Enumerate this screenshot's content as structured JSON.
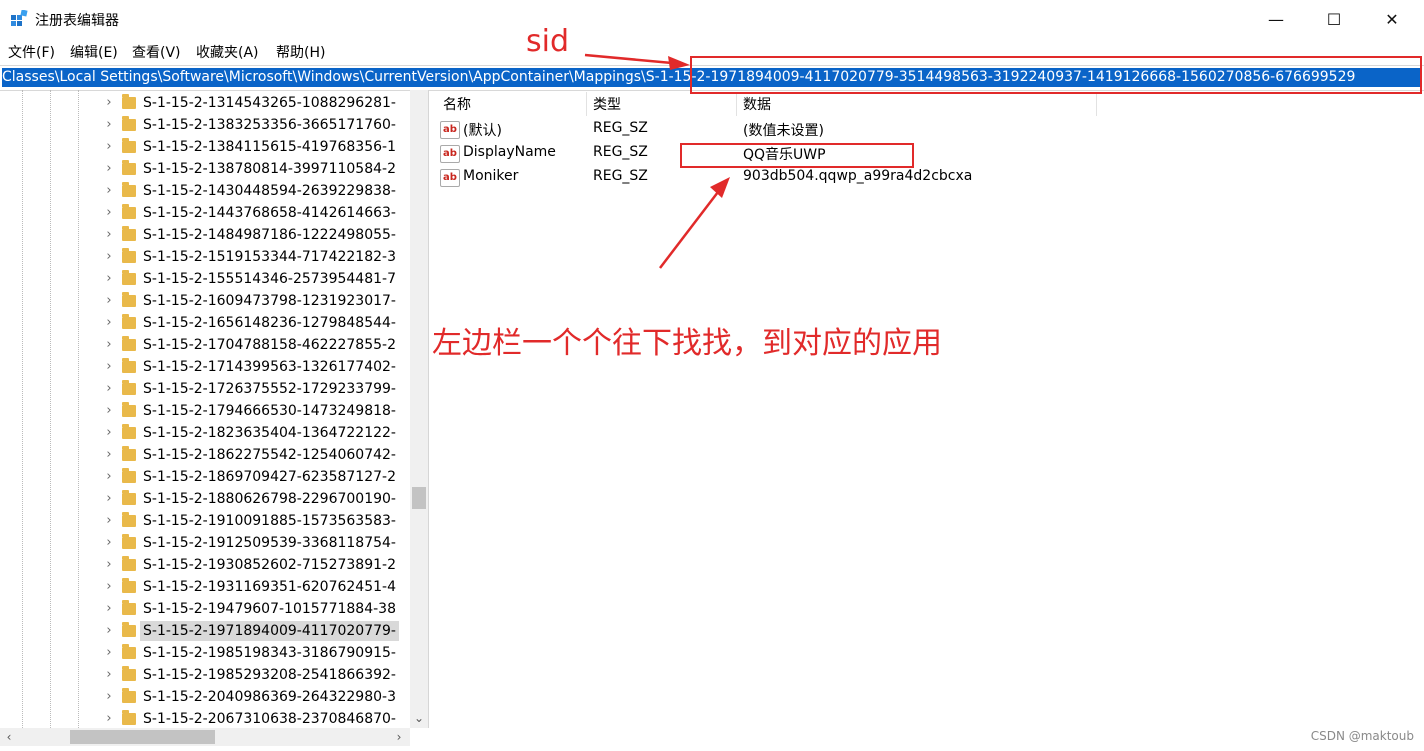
{
  "window": {
    "title": "注册表编辑器",
    "minimize_glyph": "—",
    "maximize_glyph": "☐",
    "close_glyph": "✕"
  },
  "menu": [
    "文件(F)",
    "编辑(E)",
    "查看(V)",
    "收藏夹(A)",
    "帮助(H)"
  ],
  "address": {
    "path": "Classes\\Local Settings\\Software\\Microsoft\\Windows\\CurrentVersion\\AppContainer\\Mappings\\S-1-15-2-1971894009-4117020779-3514498563-3192240937-1419126668-1560270856-676699529"
  },
  "tree": {
    "items": [
      "S-1-15-2-1314543265-1088296281-",
      "S-1-15-2-1383253356-3665171760-",
      "S-1-15-2-1384115615-419768356-1",
      "S-1-15-2-138780814-3997110584-2",
      "S-1-15-2-1430448594-2639229838-",
      "S-1-15-2-1443768658-4142614663-",
      "S-1-15-2-1484987186-1222498055-",
      "S-1-15-2-1519153344-717422182-3",
      "S-1-15-2-155514346-2573954481-7",
      "S-1-15-2-1609473798-1231923017-",
      "S-1-15-2-1656148236-1279848544-",
      "S-1-15-2-1704788158-462227855-2",
      "S-1-15-2-1714399563-1326177402-",
      "S-1-15-2-1726375552-1729233799-",
      "S-1-15-2-1794666530-1473249818-",
      "S-1-15-2-1823635404-1364722122-",
      "S-1-15-2-1862275542-1254060742-",
      "S-1-15-2-1869709427-623587127-2",
      "S-1-15-2-1880626798-2296700190-",
      "S-1-15-2-1910091885-1573563583-",
      "S-1-15-2-1912509539-3368118754-",
      "S-1-15-2-1930852602-715273891-2",
      "S-1-15-2-1931169351-620762451-4",
      "S-1-15-2-19479607-1015771884-38",
      "S-1-15-2-1971894009-4117020779-",
      "S-1-15-2-1985198343-3186790915-",
      "S-1-15-2-1985293208-2541866392-",
      "S-1-15-2-2040986369-264322980-3",
      "S-1-15-2-2067310638-2370846870-"
    ],
    "selected_index": 24
  },
  "columns": {
    "name": "名称",
    "type": "类型",
    "data": "数据"
  },
  "values": [
    {
      "name": "(默认)",
      "type": "REG_SZ",
      "data": "(数值未设置)"
    },
    {
      "name": "DisplayName",
      "type": "REG_SZ",
      "data": "QQ音乐UWP"
    },
    {
      "name": "Moniker",
      "type": "REG_SZ",
      "data": "903db504.qqwp_a99ra4d2cbcxa"
    }
  ],
  "annotations": {
    "sid_label": "sid",
    "instruction": "左边栏一个个往下找找，到对应的应用",
    "color": "#e12a2a"
  },
  "watermark": "CSDN @maktoub",
  "icons": {
    "value_icon_text": "ab"
  }
}
